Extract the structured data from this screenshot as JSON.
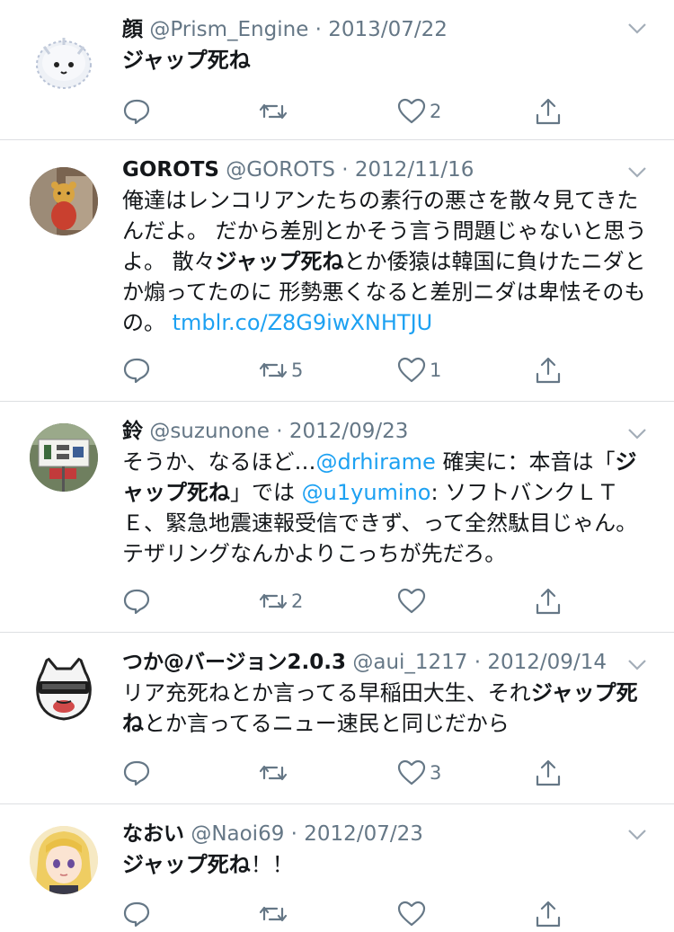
{
  "tweets": [
    {
      "name": "顔",
      "handle": "@Prism_Engine",
      "date": "2013/07/22",
      "text": [
        {
          "t": "ジャップ死ね",
          "k": "hl"
        }
      ],
      "replies": "",
      "retweets": "",
      "likes": "2"
    },
    {
      "name": "GOROTS",
      "handle": "@GOROTS",
      "date": "2012/11/16",
      "text": [
        {
          "t": "俺達はレンコリアンたちの素行の悪さを散々見てきたんだよ。 だから差別とかそう言う問題じゃないと思うよ。 散々",
          "k": ""
        },
        {
          "t": "ジャップ死ね",
          "k": "hl"
        },
        {
          "t": "とか倭猿は韓国に負けたニダとか煽ってたのに 形勢悪くなると差別ニダは卑怯そのもの。 ",
          "k": ""
        },
        {
          "t": "tmblr.co/Z8G9iwXNHTJU",
          "k": "link"
        }
      ],
      "replies": "",
      "retweets": "5",
      "likes": "1"
    },
    {
      "name": "鈴",
      "handle": "@suzunone",
      "date": "2012/09/23",
      "text": [
        {
          "t": "そうか、なるほど…",
          "k": ""
        },
        {
          "t": "@drhirame",
          "k": "link"
        },
        {
          "t": " 確実に：本音は「",
          "k": ""
        },
        {
          "t": "ジャップ死ね",
          "k": "hl"
        },
        {
          "t": "」では ",
          "k": ""
        },
        {
          "t": "@u1yumino",
          "k": "link"
        },
        {
          "t": ": ソフトバンクＬＴＥ、緊急地震速報受信できず、って全然駄目じゃん。 テザリングなんかよりこっちが先だろ。",
          "k": ""
        }
      ],
      "replies": "",
      "retweets": "2",
      "likes": ""
    },
    {
      "name": "つか@バージョン2.0.3",
      "handle": "@aui_1217",
      "date": "2012/09/14",
      "text": [
        {
          "t": "リア充死ねとか言ってる早稲田大生、それ",
          "k": ""
        },
        {
          "t": "ジャップ死ね",
          "k": "hl"
        },
        {
          "t": "とか言ってるニュー速民と同じだから",
          "k": ""
        }
      ],
      "replies": "",
      "retweets": "",
      "likes": "3"
    },
    {
      "name": "なおい",
      "handle": "@Naoi69",
      "date": "2012/07/23",
      "text": [
        {
          "t": "ジャップ死ね",
          "k": "hl"
        },
        {
          "t": "！！",
          "k": ""
        }
      ],
      "replies": "",
      "retweets": "",
      "likes": ""
    }
  ],
  "dot": "·",
  "icons": {
    "reply": "reply-icon",
    "retweet": "retweet-icon",
    "like": "heart-icon",
    "share": "share-icon",
    "menu": "chevron-down-icon"
  },
  "colors": {
    "text": "#14171a",
    "secondary": "#657786",
    "link": "#1da1f2",
    "divider": "#dddfe2"
  }
}
